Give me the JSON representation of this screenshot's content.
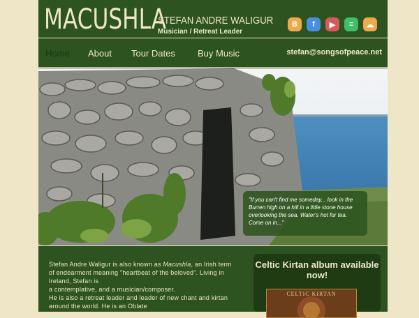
{
  "header": {
    "logo": "MACUSHLA",
    "artist_name": "STEFAN ANDRE WALIGUR",
    "role": "Musician / Retreat Leader"
  },
  "social": [
    {
      "name": "blogger-icon",
      "glyph": "B",
      "color": "#f0a94a"
    },
    {
      "name": "facebook-icon",
      "glyph": "f",
      "color": "#4a8ee0"
    },
    {
      "name": "youtube-icon",
      "glyph": "▶",
      "color": "#d65a5a"
    },
    {
      "name": "spotify-icon",
      "glyph": "≡",
      "color": "#3fbf6a"
    },
    {
      "name": "soundcloud-icon",
      "glyph": "☁",
      "color": "#f0a94a"
    }
  ],
  "nav": {
    "home": "Home",
    "about": "About",
    "tour": "Tour Dates",
    "music": "Buy Music",
    "email": "stefan@songsofpeace.net"
  },
  "hero": {
    "quote": "\"If you can't find me someday... look in the Burren high on a hill in a little stone house overlooking the sea. Water's hot for tea. Come on in...\""
  },
  "about": {
    "line1_pre": "Stefan Andre Waligur is also known as ",
    "line1_em": "Macushla",
    "line1_post": ", an Irish term of endearment meaning \"heartbeat of the beloved\". Living in Ireland, Stefan is",
    "line2": "a contemplative, and a musician/composer.",
    "line3": "He is also a retreat leader and leader of new chant and kirtan around the world. He is an Oblate"
  },
  "promo": {
    "title": "Celtic Kirtan album available now!",
    "album_text": "CELTIC KIRTAN"
  }
}
